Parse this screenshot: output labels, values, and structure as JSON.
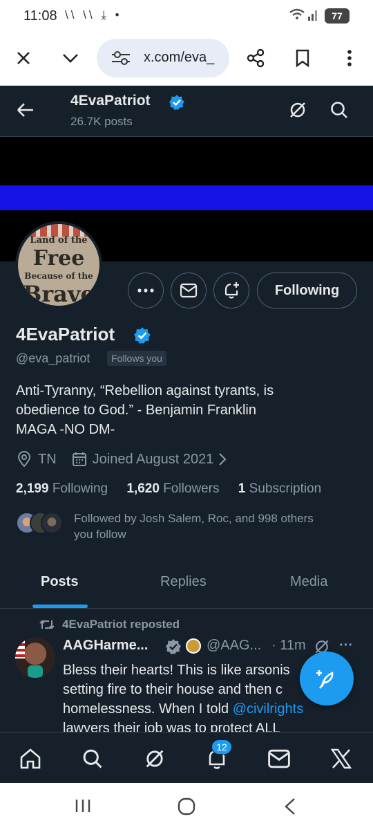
{
  "status_bar": {
    "time": "11:08",
    "notif_icons": "\\\\ \\\\ ⤓ •",
    "battery": "77"
  },
  "browser": {
    "url": "x.com/eva_"
  },
  "header": {
    "name": "4EvaPatriot",
    "posts_count": "26.7K posts"
  },
  "profile": {
    "name": "4EvaPatriot",
    "handle": "@eva_patriot",
    "follows_you": "Follows you",
    "follow_button": "Following",
    "bio": [
      "Anti-Tyranny, “Rebellion against tyrants, is",
      "obedience to God.” - Benjamin Franklin",
      "MAGA -NO DM-"
    ],
    "location": "TN",
    "joined": "Joined August 2021",
    "following_count": "2,199",
    "following_label": "Following",
    "followers_count": "1,620",
    "followers_label": "Followers",
    "subscription_count": "1",
    "subscription_label": "Subscription",
    "followed_by": [
      "Followed by Josh Salem, Roc, and 998 others",
      "you follow"
    ],
    "avatar_text": [
      "Land of the",
      "Free",
      "Because of the",
      "Brave"
    ]
  },
  "tabs": [
    "Posts",
    "Replies",
    "Media"
  ],
  "tweet": {
    "repost_label": "4EvaPatriot reposted",
    "author": "AAGHarme...",
    "handle": "@AAG...",
    "time": "· 11m",
    "more": "···",
    "lines": [
      "Bless their hearts! This is like arsonis",
      "setting fire to their house and then c",
      "homelessness. When I told ",
      "lawyers their job was to protect ALL"
    ],
    "mention": "@civilrights"
  },
  "bottom_nav": {
    "notifications_badge": "12"
  },
  "colors": {
    "background": "#15202b",
    "accent": "#1d9bf0",
    "muted": "#8b98a5",
    "banner_stripe": "#1414e6"
  }
}
